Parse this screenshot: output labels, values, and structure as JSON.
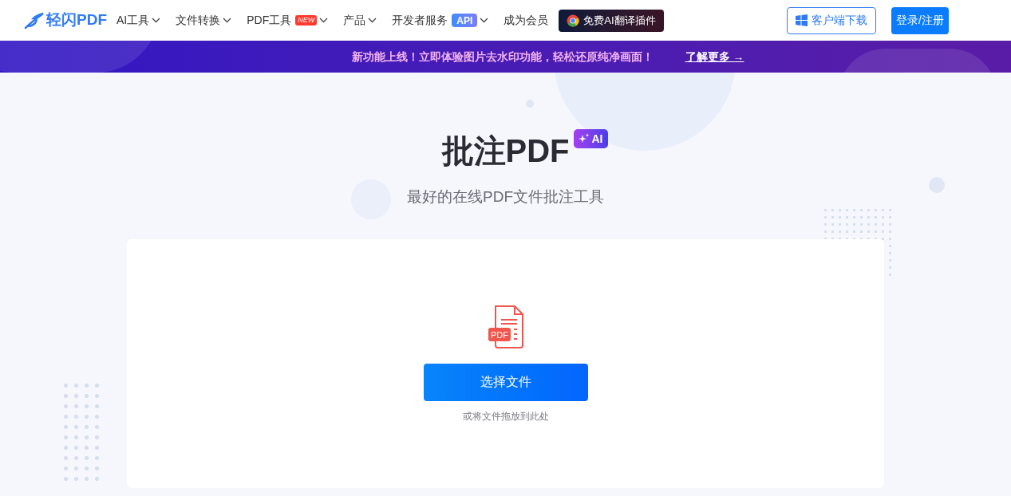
{
  "header": {
    "logo": "轻闪PDF",
    "nav": [
      {
        "label": "AI工具",
        "dropdown": true
      },
      {
        "label": "文件转换",
        "dropdown": true
      },
      {
        "label": "PDF工具",
        "dropdown": true,
        "badge": {
          "text": "NEW",
          "kind": "new"
        }
      },
      {
        "label": "产品",
        "dropdown": true
      },
      {
        "label": "开发者服务",
        "dropdown": true,
        "badge": {
          "text": "API",
          "kind": "api"
        }
      },
      {
        "label": "成为会员",
        "dropdown": false
      }
    ],
    "plugin_button": "免费AI翻译插件",
    "download_button": "客户端下载",
    "login_button": "登录/注册"
  },
  "banner": {
    "text": "新功能上线！立即体验图片去水印功能，轻松还原纯净画面！",
    "link": "了解更多",
    "arrow": "→"
  },
  "hero": {
    "title": "批注PDF",
    "ai_badge": "AI",
    "subtitle": "最好的在线PDF文件批注工具"
  },
  "upload": {
    "file_icon_label": "PDF",
    "button": "选择文件",
    "hint": "或将文件拖放到此处"
  }
}
